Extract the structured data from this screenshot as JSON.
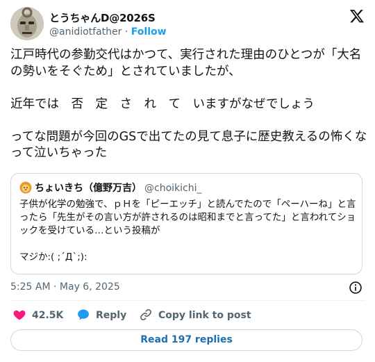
{
  "author": {
    "display_name": "とうちゃんD@2026S",
    "handle": "@anidiotfather",
    "separator": "·",
    "follow_label": "Follow"
  },
  "tweet": {
    "text": "江戸時代の参勤交代はかつて、実行された理由のひとつが「大名の勢いをそぐため」とされていましたが、\n\n近年では　否　定　さ　れ　て　いますがなぜでしょう\n\nってな問題が今回のGSで出てたの見て息子に歴史教えるの怖くなって泣いちゃった"
  },
  "quote": {
    "display_name": "ちょいきち（億野万吉）",
    "handle": "@choikichi_",
    "text": "子供が化学の勉強で、ｐＨを「ピーエッチ」と読んでたので「ペーハーね」と言ったら「先生がその言い方が許されるのは昭和までと言ってた」と言われてショックを受けている…という投稿が\n\nマジか:( ;´Д`;):"
  },
  "meta": {
    "time": "5:25 AM",
    "separator": "·",
    "date": "May 6, 2025"
  },
  "actions": {
    "likes": "42.5K",
    "reply_label": "Reply",
    "copy_label": "Copy link to post"
  },
  "read_replies_label": "Read 197 replies",
  "colors": {
    "accent": "#1d9bf0",
    "like": "#f91880",
    "muted": "#536471"
  }
}
